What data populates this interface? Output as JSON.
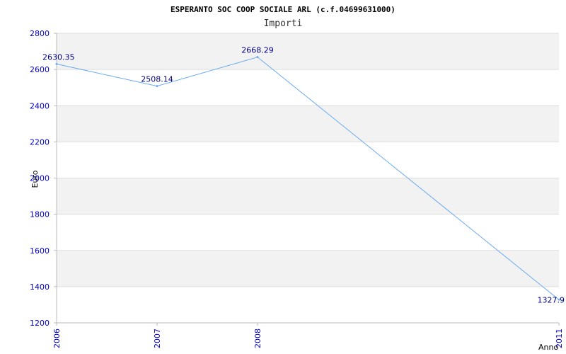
{
  "chart_data": {
    "type": "line",
    "title": "ESPERANTO SOC COOP SOCIALE ARL (c.f.04699631000)",
    "subtitle": "Importi",
    "xlabel": "Anno",
    "ylabel": "Euro",
    "x": [
      2006,
      2007,
      2008,
      2011
    ],
    "x_tick_labels": [
      "2006",
      "2007",
      "2008",
      "2011"
    ],
    "y_tick_labels": [
      "1200",
      "1400",
      "1600",
      "1800",
      "2000",
      "2200",
      "2400",
      "2600",
      "2800"
    ],
    "series": [
      {
        "values": [
          2630.35,
          2508.14,
          2668.29,
          1327.9
        ],
        "data_labels": [
          "2630.35",
          "2508.14",
          "2668.29",
          "1327.9"
        ]
      }
    ],
    "ylim": [
      1200,
      2800
    ],
    "grid": true,
    "colors": {
      "line": "#6aaaf0",
      "band": "#f2f2f2",
      "grid": "#dddddd",
      "axis": "#bbbbbb",
      "tick_text": "#0000cc",
      "data_label": "#000080"
    }
  }
}
